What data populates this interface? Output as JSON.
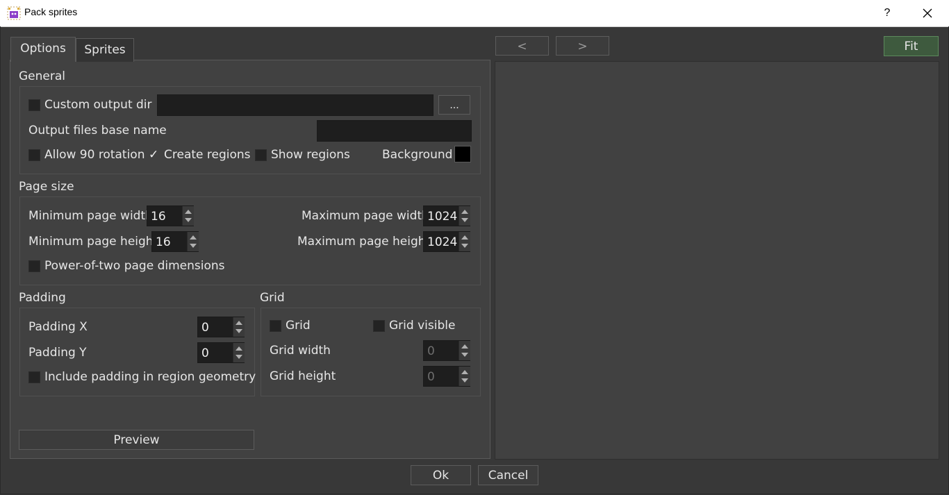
{
  "window": {
    "title": "Pack sprites",
    "help": "?"
  },
  "tabs": [
    {
      "label": "Options"
    },
    {
      "label": "Sprites"
    }
  ],
  "general": {
    "title": "General",
    "custom_output_dir_label": "Custom output dir",
    "custom_output_dir_checked": false,
    "browse_label": "...",
    "base_name_label": "Output files base name",
    "allow_rotation_label": "Allow 90 rotation",
    "create_regions_label": "Create regions",
    "create_regions_checked": true,
    "show_regions_label": "Show regions",
    "background_label": "Background",
    "background_color": "#000000"
  },
  "page_size": {
    "title": "Page size",
    "min_width_label": "Minimum page width",
    "min_width": "16",
    "max_width_label": "Maximum page width",
    "max_width": "1024",
    "min_height_label": "Minimum page height",
    "min_height": "16",
    "max_height_label": "Maximum page height",
    "max_height": "1024",
    "pow2_label": "Power-of-two page dimensions"
  },
  "padding": {
    "title": "Padding",
    "x_label": "Padding X",
    "x": "0",
    "y_label": "Padding Y",
    "y": "0",
    "include_label": "Include padding in region geometry"
  },
  "grid": {
    "title": "Grid",
    "grid_label": "Grid",
    "visible_label": "Grid visible",
    "width_label": "Grid width",
    "width": "0",
    "height_label": "Grid height",
    "height": "0"
  },
  "preview_label": "Preview",
  "nav": {
    "prev": "<",
    "next": ">",
    "fit": "Fit"
  },
  "footer": {
    "ok": "Ok",
    "cancel": "Cancel"
  }
}
